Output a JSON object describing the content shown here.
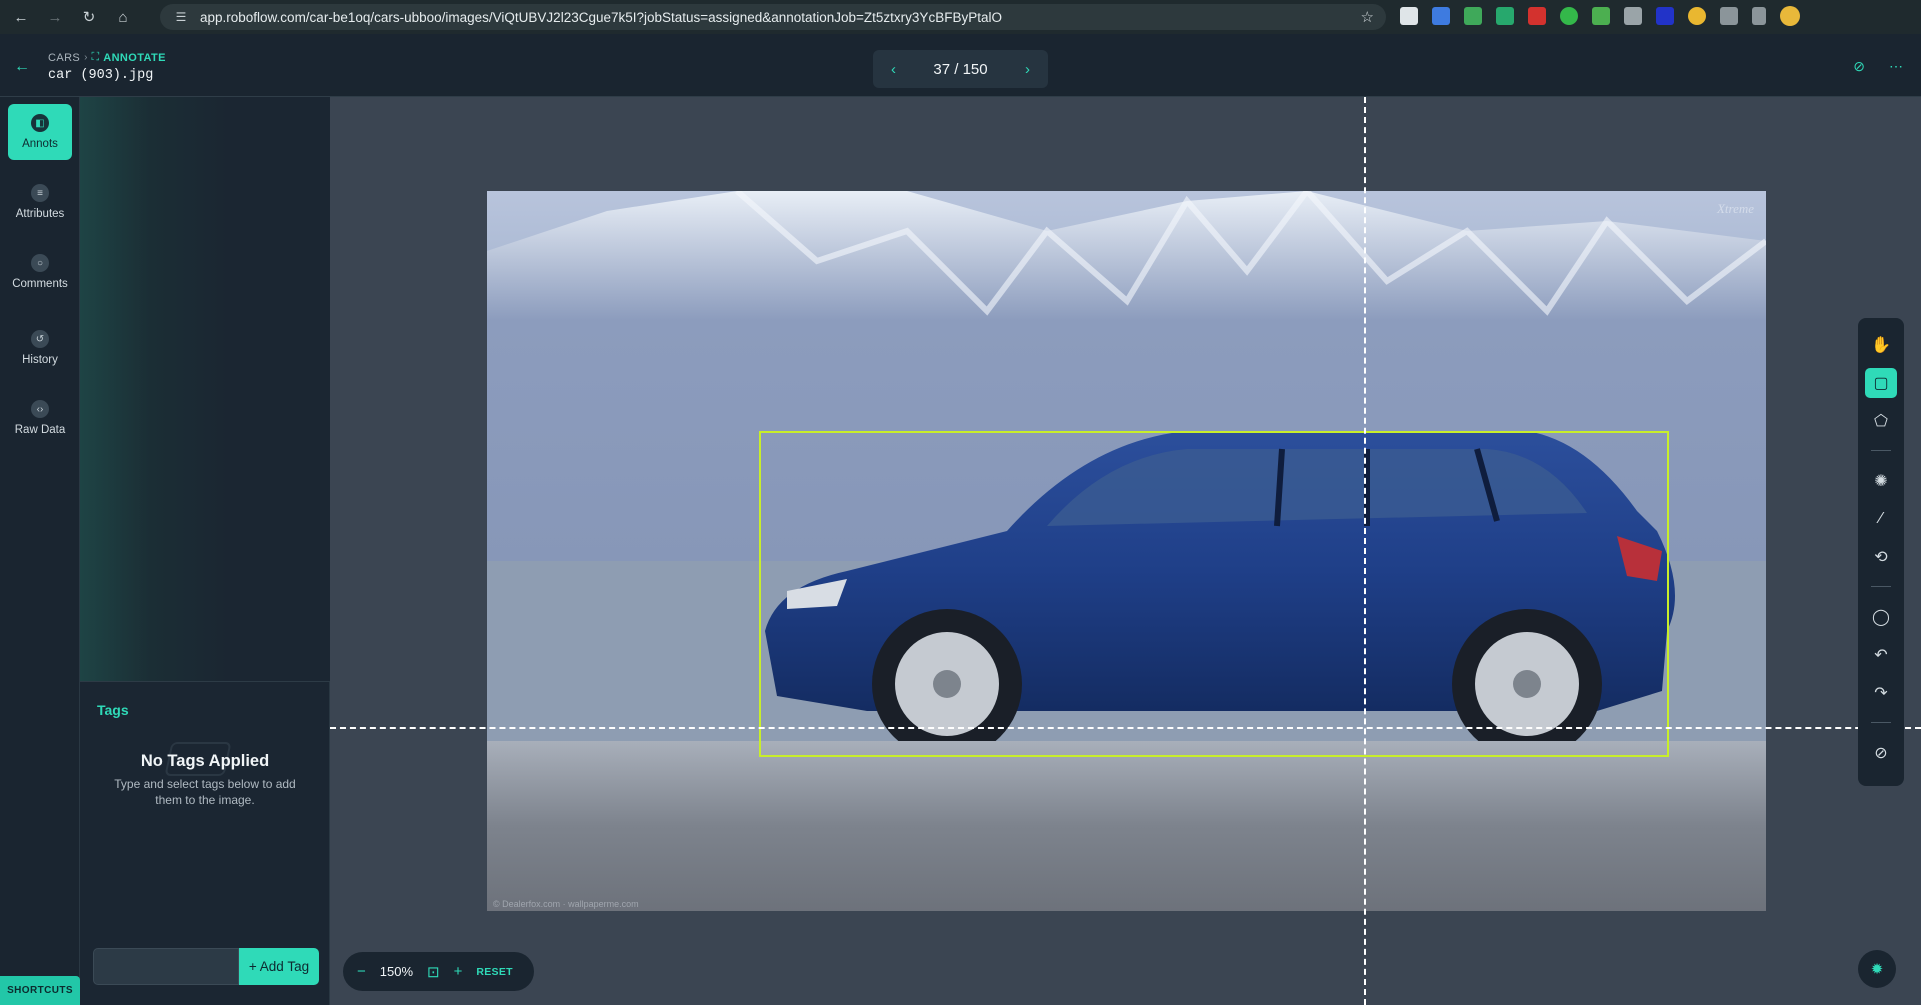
{
  "browser": {
    "url": "app.roboflow.com/car-be1oq/cars-ubboo/images/ViQtUBVJ2l23Cgue7k5I?jobStatus=assigned&annotationJob=Zt5ztxry3YcBFByPtalO"
  },
  "header": {
    "crumb_project": "CARS",
    "crumb_active": "ANNOTATE",
    "file_name": "car (903).jpg",
    "pager": "37 / 150"
  },
  "rail": {
    "items": [
      {
        "label": "Annots",
        "icon": "annotations-icon",
        "active": true
      },
      {
        "label": "Attributes",
        "icon": "attributes-icon",
        "active": false
      },
      {
        "label": "Comments",
        "icon": "comments-icon",
        "active": false
      },
      {
        "label": "History",
        "icon": "history-icon",
        "active": false
      },
      {
        "label": "Raw Data",
        "icon": "code-icon",
        "active": false
      }
    ],
    "shortcuts": "SHORTCUTS"
  },
  "tags": {
    "title": "Tags",
    "empty_title": "No Tags Applied",
    "empty_desc": "Type and select tags below to add them to the image.",
    "input_value": "",
    "add_label": "+ Add Tag"
  },
  "canvas": {
    "watermark": "Xtreme",
    "credit": "© Dealerfox.com · wallpaperme.com",
    "bounding_box_color": "#c8ee2a"
  },
  "zoom": {
    "minus": "−",
    "value": "150%",
    "plus": "+",
    "reset": "RESET"
  },
  "toolbar": {
    "tools": [
      "drag-tool-icon",
      "bounding-box-tool-icon",
      "polygon-tool-icon",
      "smart-polygon-icon",
      "magic-wand-icon",
      "repeat-previous-icon",
      "comment-tool-icon",
      "undo-icon",
      "redo-icon",
      "hide-annotations-icon"
    ]
  },
  "colors": {
    "accent": "#2fdab8",
    "background": "#1a2530",
    "canvas": "#3b4552"
  }
}
